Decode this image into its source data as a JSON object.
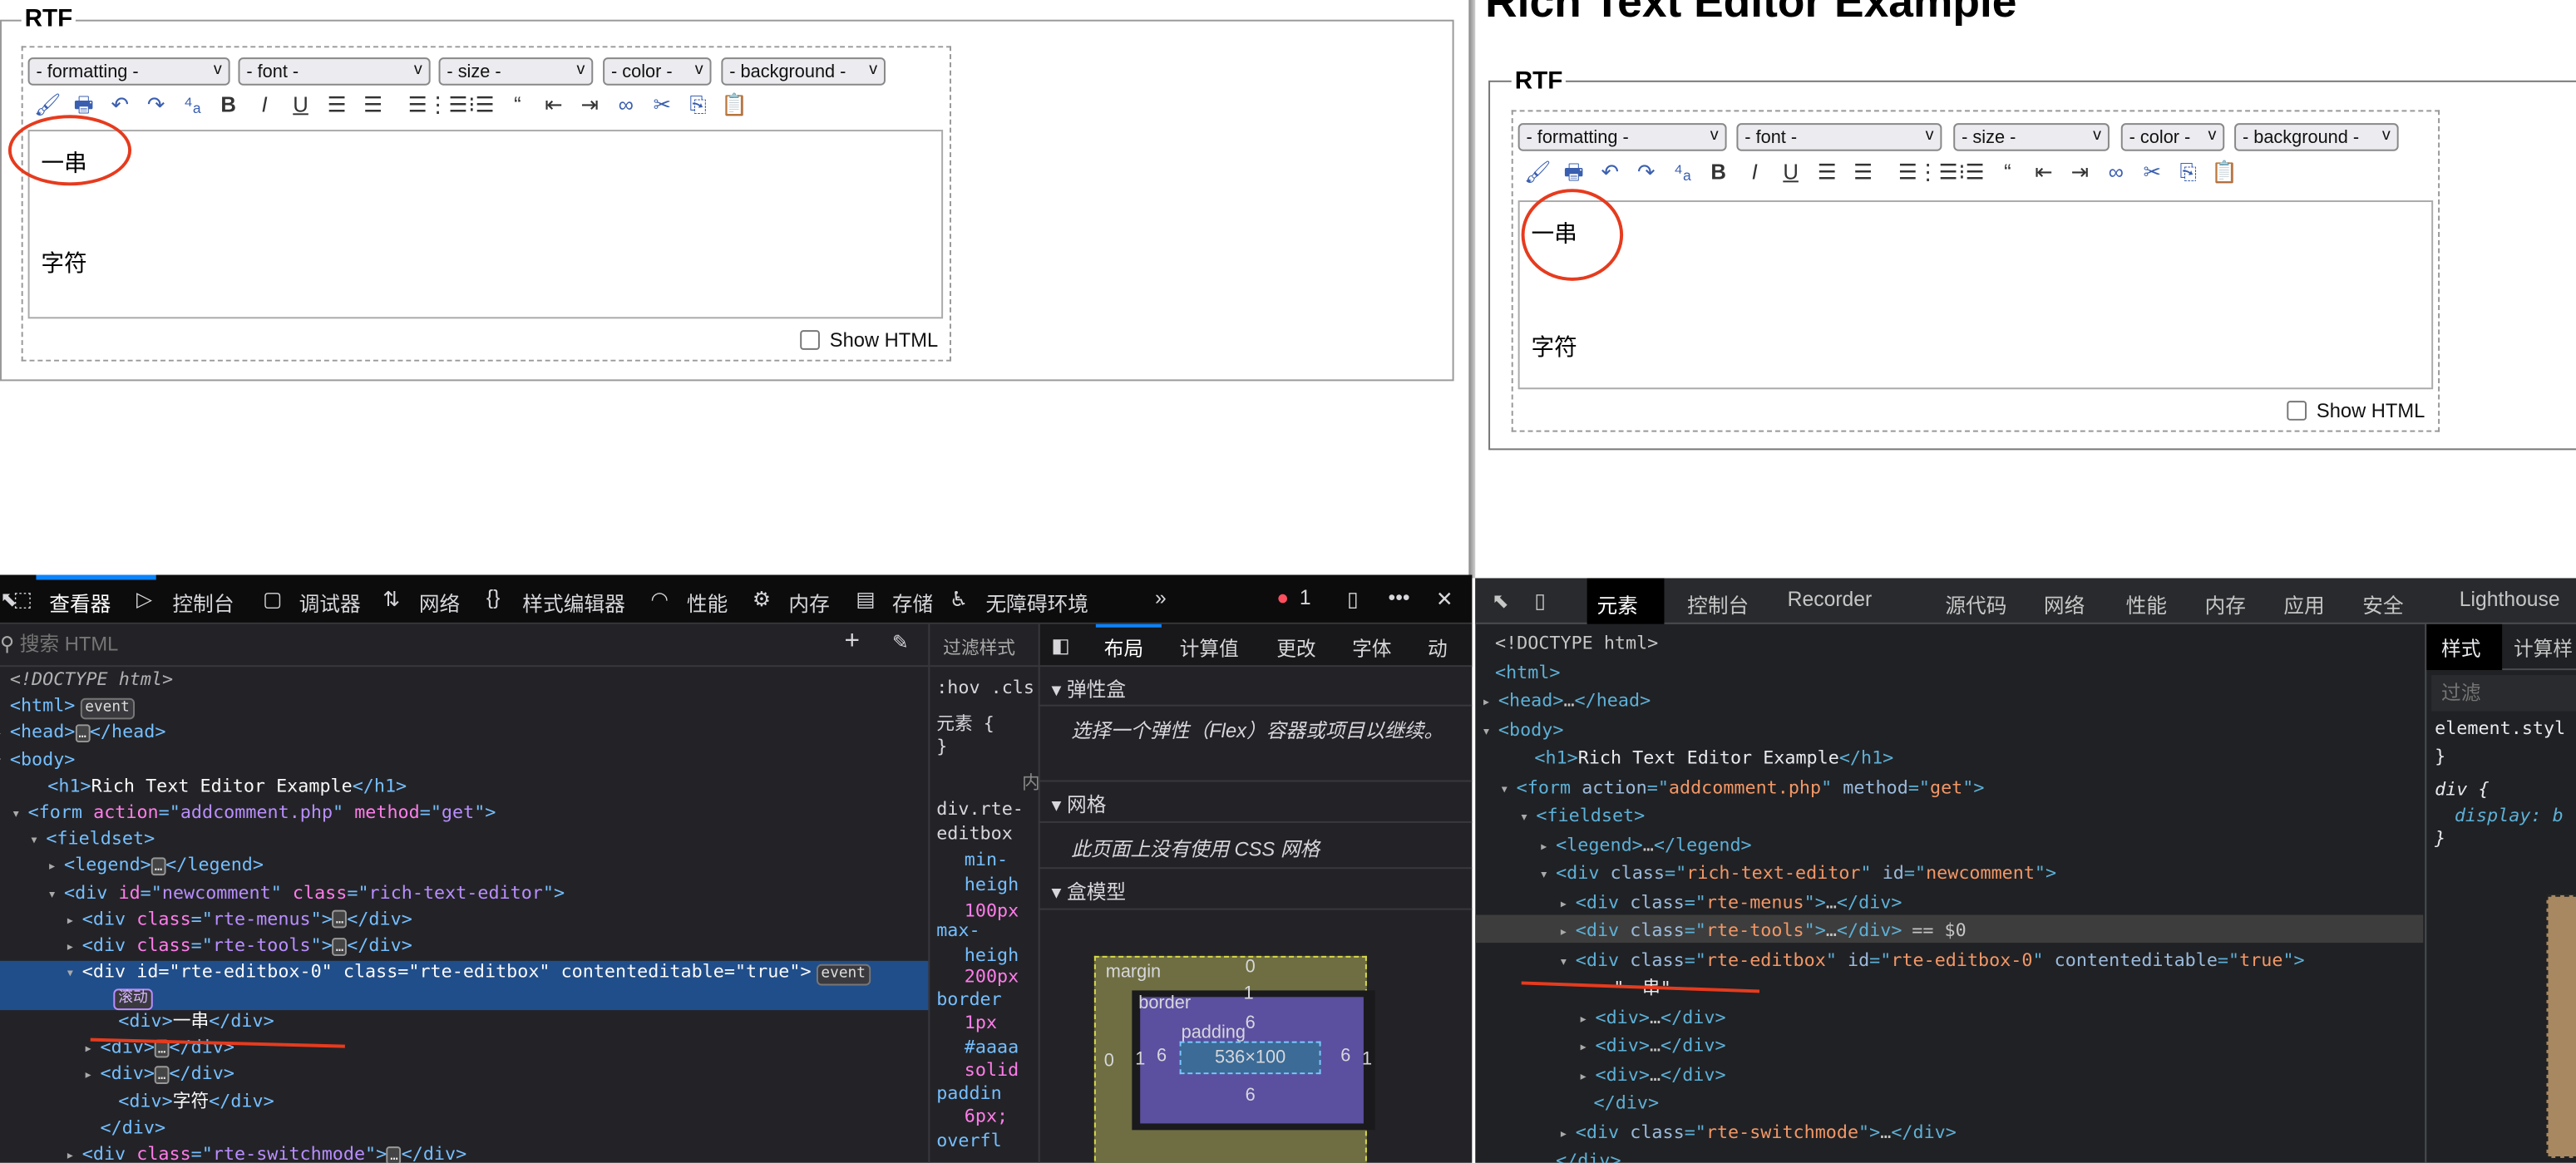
{
  "left_page": {
    "legend": "RTF",
    "selects": [
      "- formatting -",
      "- font -",
      "- size -",
      "- color -",
      "- background -"
    ],
    "editor_lines": [
      "一串",
      "字符"
    ],
    "show_html_label": "Show HTML",
    "show_html_checked": false
  },
  "right_page": {
    "heading": "Rich Text Editor Example",
    "legend": "RTF",
    "selects": [
      "- formatting -",
      "- font -",
      "- size -",
      "- color -",
      "- background -"
    ],
    "editor_lines": [
      "一串",
      "字符"
    ],
    "show_html_label": "Show HTML",
    "show_html_checked": false
  },
  "toolbar_icons": [
    {
      "name": "clean-brush-icon",
      "glyph": "🖌"
    },
    {
      "name": "print-icon",
      "glyph": "🖶"
    },
    {
      "name": "undo-icon",
      "glyph": "↶"
    },
    {
      "name": "redo-icon",
      "glyph": "↷"
    },
    {
      "name": "spellcheck-icon",
      "glyph": "⁴ₐ"
    },
    {
      "name": "bold-icon",
      "glyph": "B"
    },
    {
      "name": "italic-icon",
      "glyph": "I"
    },
    {
      "name": "underline-icon",
      "glyph": "U"
    },
    {
      "name": "align-left-icon",
      "glyph": "☰"
    },
    {
      "name": "align-center-icon",
      "glyph": "☰"
    },
    {
      "name": "align-right-icon",
      "glyph": "☰"
    },
    {
      "name": "ordered-list-icon",
      "glyph": "⋮☰"
    },
    {
      "name": "unordered-list-icon",
      "glyph": "⁝☰"
    },
    {
      "name": "blockquote-icon",
      "glyph": "“"
    },
    {
      "name": "outdent-icon",
      "glyph": "⇤"
    },
    {
      "name": "indent-icon",
      "glyph": "⇥"
    },
    {
      "name": "link-icon",
      "glyph": "∞"
    },
    {
      "name": "cut-icon",
      "glyph": "✂"
    },
    {
      "name": "copy-icon",
      "glyph": "⎘"
    },
    {
      "name": "paste-icon",
      "glyph": "📋"
    }
  ],
  "annotation_color": "#e63b1e",
  "firefox": {
    "tabs": [
      "查看器",
      "控制台",
      "调试器",
      "网络",
      "样式编辑器",
      "性能",
      "内存",
      "存储",
      "无障碍环境"
    ],
    "error_count": "1",
    "search_placeholder": "搜索 HTML",
    "filter_styles": "过滤样式",
    "layout_tabs": [
      "布局",
      "计算值",
      "更改",
      "字体",
      "动"
    ],
    "rules": [
      ":hov .cls",
      "元素 {",
      "}",
      "内",
      "div.rte-",
      "editbox",
      "min-",
      "heigh",
      "100px",
      "max-",
      "heigh",
      "200px",
      "border",
      "1px",
      "#aaaa",
      "solid",
      "paddin",
      "6px;",
      "overfl"
    ],
    "sections": {
      "flex_title": "弹性盒",
      "flex_text": "选择一个弹性（Flex）容器或项目以继续。",
      "grid_title": "网格",
      "grid_text": "此页面上没有使用 CSS 网格",
      "box_title": "盒模型"
    },
    "box_model": {
      "margin_label": "margin",
      "border_label": "border",
      "padding_label": "padding",
      "margin": "0",
      "border": "1",
      "padding": "6",
      "content": "536×100"
    },
    "tree": [
      {
        "i": 6,
        "a": "",
        "t": [
          [
            "dt",
            "<!DOCTYPE html>"
          ]
        ]
      },
      {
        "i": 6,
        "a": "",
        "t": [
          [
            "tg",
            "<html>"
          ]
        ],
        "b": "event"
      },
      {
        "i": 6,
        "a": "▸",
        "t": [
          [
            "tg",
            "<head>"
          ],
          [
            "el",
            "…"
          ],
          [
            "tg",
            "</head>"
          ]
        ]
      },
      {
        "i": 6,
        "a": "▾",
        "t": [
          [
            "tg",
            "<body>"
          ]
        ]
      },
      {
        "i": 29,
        "a": "",
        "t": [
          [
            "tg",
            "<h1>"
          ],
          [
            "tx",
            "Rich Text Editor Example"
          ],
          [
            "tg",
            "</h1>"
          ]
        ]
      },
      {
        "i": 17,
        "a": "▾",
        "t": [
          [
            "tg",
            "<form "
          ],
          [
            "an",
            "action"
          ],
          [
            "tg",
            "=\""
          ],
          [
            "av",
            "addcomment.php"
          ],
          [
            "tg",
            "\" "
          ],
          [
            "an",
            "method"
          ],
          [
            "tg",
            "=\""
          ],
          [
            "av",
            "get"
          ],
          [
            "tg",
            "\">"
          ]
        ]
      },
      {
        "i": 28,
        "a": "▾",
        "t": [
          [
            "tg",
            "<fieldset>"
          ]
        ]
      },
      {
        "i": 39,
        "a": "▸",
        "t": [
          [
            "tg",
            "<legend>"
          ],
          [
            "el",
            "…"
          ],
          [
            "tg",
            "</legend>"
          ]
        ]
      },
      {
        "i": 39,
        "a": "▾",
        "t": [
          [
            "tg",
            "<div "
          ],
          [
            "an",
            "id"
          ],
          [
            "tg",
            "=\""
          ],
          [
            "av",
            "newcomment"
          ],
          [
            "tg",
            "\" "
          ],
          [
            "an",
            "class"
          ],
          [
            "tg",
            "=\""
          ],
          [
            "av",
            "rich-text-editor"
          ],
          [
            "tg",
            "\">"
          ]
        ]
      },
      {
        "i": 50,
        "a": "▸",
        "t": [
          [
            "tg",
            "<div "
          ],
          [
            "an",
            "class"
          ],
          [
            "tg",
            "=\""
          ],
          [
            "av",
            "rte-menus"
          ],
          [
            "tg",
            "\">"
          ],
          [
            "el",
            "…"
          ],
          [
            "tg",
            "</div>"
          ]
        ]
      },
      {
        "i": 50,
        "a": "▸",
        "t": [
          [
            "tg",
            "<div "
          ],
          [
            "an",
            "class"
          ],
          [
            "tg",
            "=\""
          ],
          [
            "av",
            "rte-tools"
          ],
          [
            "tg",
            "\">"
          ],
          [
            "el",
            "…"
          ],
          [
            "tg",
            "</div>"
          ]
        ]
      },
      {
        "i": 50,
        "a": "▾",
        "t": [
          [
            "tx",
            "<div "
          ],
          [
            "tx",
            "id=\"rte-editbox-0\" "
          ],
          [
            "tx",
            "class=\"rte-editbox\" "
          ],
          [
            "tx",
            "contenteditable=\"true\">"
          ]
        ],
        "b": "event",
        "b2": "滚动",
        "sel": true
      },
      {
        "i": 72,
        "a": "",
        "t": [
          [
            "tg",
            "<div>"
          ],
          [
            "tx",
            "一串"
          ],
          [
            "tg",
            "</div>"
          ]
        ]
      },
      {
        "i": 61,
        "a": "▸",
        "t": [
          [
            "tg",
            "<div>"
          ],
          [
            "el",
            "…"
          ],
          [
            "tg",
            "</div>"
          ]
        ]
      },
      {
        "i": 61,
        "a": "▸",
        "t": [
          [
            "tg",
            "<div>"
          ],
          [
            "el",
            "…"
          ],
          [
            "tg",
            "</div>"
          ]
        ]
      },
      {
        "i": 72,
        "a": "",
        "t": [
          [
            "tg",
            "<div>"
          ],
          [
            "tx",
            "字符"
          ],
          [
            "tg",
            "</div>"
          ]
        ]
      },
      {
        "i": 61,
        "a": "",
        "t": [
          [
            "tg",
            "</div>"
          ]
        ]
      },
      {
        "i": 50,
        "a": "▸",
        "t": [
          [
            "tg",
            "<div "
          ],
          [
            "an",
            "class"
          ],
          [
            "tg",
            "=\""
          ],
          [
            "av",
            "rte-switchmode"
          ],
          [
            "tg",
            "\">"
          ],
          [
            "el",
            "…"
          ],
          [
            "tg",
            "</div>"
          ]
        ]
      }
    ]
  },
  "chrome": {
    "tabs": [
      "元素",
      "控制台",
      "Recorder",
      "源代码",
      "网络",
      "性能",
      "内存",
      "应用",
      "安全",
      "Lighthouse"
    ],
    "styles_tabs": [
      "样式",
      "计算样"
    ],
    "filter_placeholder": "过滤",
    "styles": [
      "element.styl",
      "}",
      "div {",
      "display: b",
      "}"
    ],
    "selected_marker": "== $0",
    "tree": [
      {
        "i": 12,
        "a": "",
        "t": [
          [
            "dt",
            "<!DOCTYPE html>"
          ]
        ]
      },
      {
        "i": 12,
        "a": "",
        "t": [
          [
            "tg",
            "<html>"
          ]
        ]
      },
      {
        "i": 14,
        "a": "▸",
        "t": [
          [
            "tg",
            "<head>"
          ],
          [
            "dt",
            "…"
          ],
          [
            "tg",
            "</head>"
          ]
        ]
      },
      {
        "i": 14,
        "a": "▾",
        "t": [
          [
            "tg",
            "<body>"
          ]
        ]
      },
      {
        "i": 36,
        "a": "",
        "t": [
          [
            "tg",
            "<h1>"
          ],
          [
            "tx",
            "Rich Text Editor Example"
          ],
          [
            "tg",
            "</h1>"
          ]
        ]
      },
      {
        "i": 25,
        "a": "▾",
        "t": [
          [
            "tg",
            "<form "
          ],
          [
            "an",
            "action"
          ],
          [
            "tg",
            "=\""
          ],
          [
            "av",
            "addcomment.php"
          ],
          [
            "tg",
            "\" "
          ],
          [
            "an",
            "method"
          ],
          [
            "tg",
            "=\""
          ],
          [
            "av",
            "get"
          ],
          [
            "tg",
            "\">"
          ]
        ]
      },
      {
        "i": 37,
        "a": "▾",
        "t": [
          [
            "tg",
            "<fieldset>"
          ]
        ]
      },
      {
        "i": 49,
        "a": "▸",
        "t": [
          [
            "tg",
            "<legend>"
          ],
          [
            "dt",
            "…"
          ],
          [
            "tg",
            "</legend>"
          ]
        ]
      },
      {
        "i": 49,
        "a": "▾",
        "t": [
          [
            "tg",
            "<div "
          ],
          [
            "an",
            "class"
          ],
          [
            "tg",
            "=\""
          ],
          [
            "av",
            "rich-text-editor"
          ],
          [
            "tg",
            "\" "
          ],
          [
            "an",
            "id"
          ],
          [
            "tg",
            "=\""
          ],
          [
            "av",
            "newcomment"
          ],
          [
            "tg",
            "\">"
          ]
        ]
      },
      {
        "i": 61,
        "a": "▸",
        "t": [
          [
            "tg",
            "<div "
          ],
          [
            "an",
            "class"
          ],
          [
            "tg",
            "=\""
          ],
          [
            "av",
            "rte-menus"
          ],
          [
            "tg",
            "\">"
          ],
          [
            "dt",
            "…"
          ],
          [
            "tg",
            "</div>"
          ]
        ]
      },
      {
        "i": 61,
        "a": "▸",
        "t": [
          [
            "tg",
            "<div "
          ],
          [
            "an",
            "class"
          ],
          [
            "tg",
            "=\""
          ],
          [
            "av",
            "rte-tools"
          ],
          [
            "tg",
            "\">"
          ],
          [
            "dt",
            "…"
          ],
          [
            "tg",
            "</div>"
          ]
        ],
        "m": true,
        "sel": true
      },
      {
        "i": 61,
        "a": "▾",
        "t": [
          [
            "tg",
            "<div "
          ],
          [
            "an",
            "class"
          ],
          [
            "tg",
            "=\""
          ],
          [
            "av",
            "rte-editbox"
          ],
          [
            "tg",
            "\" "
          ],
          [
            "an",
            "id"
          ],
          [
            "tg",
            "=\""
          ],
          [
            "av",
            "rte-editbox-0"
          ],
          [
            "tg",
            "\" "
          ],
          [
            "an",
            "contenteditable"
          ],
          [
            "tg",
            "=\""
          ],
          [
            "av",
            "true"
          ],
          [
            "tg",
            "\">"
          ]
        ]
      },
      {
        "i": 84,
        "a": "",
        "t": [
          [
            "tx",
            "\"一串\""
          ]
        ]
      },
      {
        "i": 73,
        "a": "▸",
        "t": [
          [
            "tg",
            "<div>"
          ],
          [
            "dt",
            "…"
          ],
          [
            "tg",
            "</div>"
          ]
        ]
      },
      {
        "i": 73,
        "a": "▸",
        "t": [
          [
            "tg",
            "<div>"
          ],
          [
            "dt",
            "…"
          ],
          [
            "tg",
            "</div>"
          ]
        ]
      },
      {
        "i": 73,
        "a": "▸",
        "t": [
          [
            "tg",
            "<div>"
          ],
          [
            "dt",
            "…"
          ],
          [
            "tg",
            "</div>"
          ]
        ]
      },
      {
        "i": 72,
        "a": "",
        "t": [
          [
            "tg",
            "</div>"
          ]
        ]
      },
      {
        "i": 61,
        "a": "▸",
        "t": [
          [
            "tg",
            "<div "
          ],
          [
            "an",
            "class"
          ],
          [
            "tg",
            "=\""
          ],
          [
            "av",
            "rte-switchmode"
          ],
          [
            "tg",
            "\">"
          ],
          [
            "dt",
            "…"
          ],
          [
            "tg",
            "</div>"
          ]
        ]
      },
      {
        "i": 49,
        "a": "",
        "t": [
          [
            "tg",
            "</div>"
          ]
        ]
      }
    ]
  }
}
